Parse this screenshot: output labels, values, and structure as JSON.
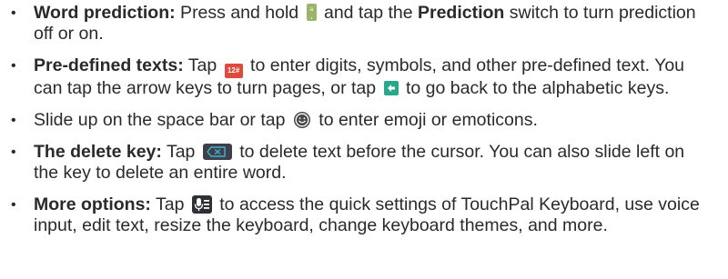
{
  "bullet_glyph": "•",
  "items": [
    {
      "term": "Word prediction:",
      "text_before_icon": " Press and hold ",
      "icon": "comma-key-icon",
      "text_after_term_word_pre": " and tap the ",
      "bold_inline": "Prediction",
      "text_after_bold": " switch to turn prediction off or on."
    },
    {
      "term": "Pre-defined texts:",
      "text_before_icon": " Tap ",
      "icon": "digits-symbols-key-icon",
      "icon_label": "12#",
      "text_mid": " to enter digits, symbols, and other pre-defined text. You can tap the arrow keys to turn pages, or tap ",
      "icon2": "back-arrow-key-icon",
      "text_after": " to go back to the alphabetic keys."
    },
    {
      "text_before_icon": "Slide up on the space bar or tap ",
      "icon": "emoji-icon",
      "text_after": " to enter emoji or emoticons."
    },
    {
      "term": "The delete key:",
      "text_before_icon": " Tap ",
      "icon": "delete-key-icon",
      "text_after": " to delete text before the cursor. You can also slide left on the key to delete an entire word."
    },
    {
      "term": "More options:",
      "text_before_icon": " Tap ",
      "icon": "more-options-key-icon",
      "text_after": " to access the quick settings of TouchPal Keyboard, use voice input, edit text, resize the keyboard, change keyboard themes, and more."
    }
  ],
  "colors": {
    "text": "#2a2a2a",
    "comma_key": "#9bb56a",
    "digits_key": "#e04a3c",
    "back_key": "#27a88a",
    "delete_key": "#3e3f49",
    "mic_key": "#2f3036"
  }
}
